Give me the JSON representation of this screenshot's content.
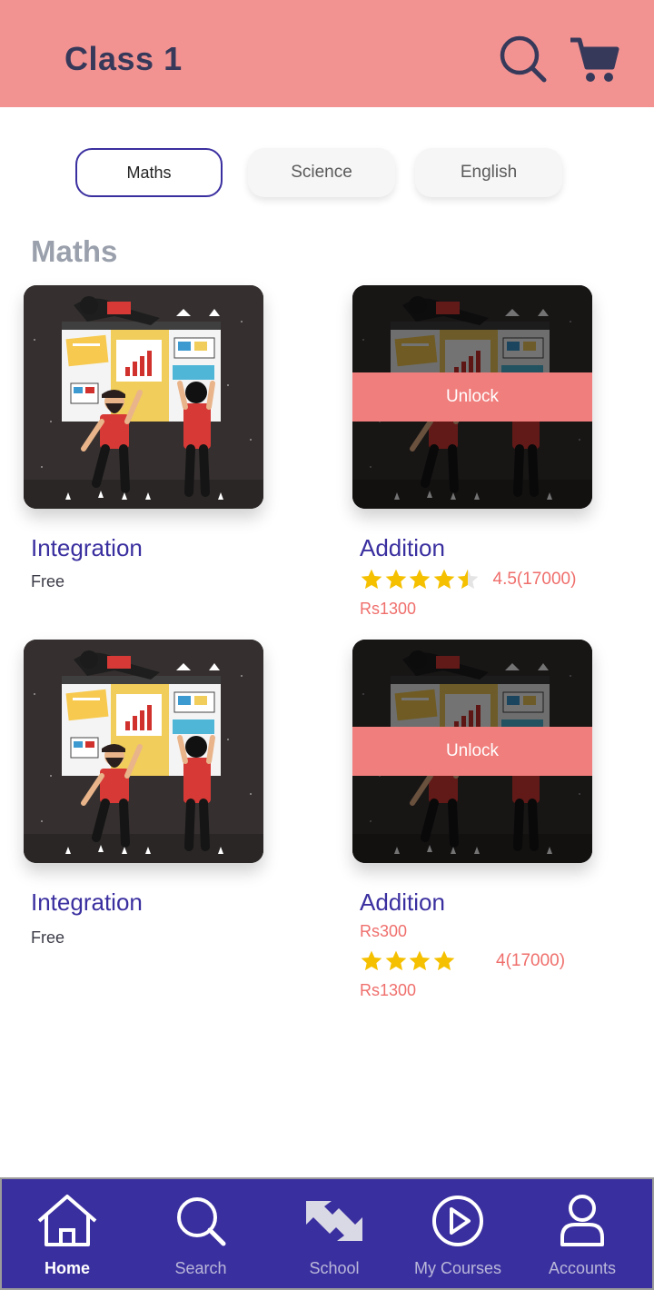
{
  "header": {
    "title": "Class 1",
    "search_icon": "search-icon",
    "cart_icon": "cart-icon"
  },
  "tabs": [
    {
      "label": "Maths",
      "active": true
    },
    {
      "label": "Science",
      "active": false
    },
    {
      "label": "English",
      "active": false
    }
  ],
  "section": {
    "title": "Maths"
  },
  "courses": [
    {
      "title": "Integration",
      "price_label": "Free",
      "locked": false
    },
    {
      "title": "Addition",
      "locked": true,
      "unlock_label": "Unlock",
      "rating": 4.5,
      "rating_text": "4.5(17000)",
      "price": "Rs1300"
    },
    {
      "title": "Integration",
      "price_label": "Free",
      "locked": false
    },
    {
      "title": "Addition",
      "locked": true,
      "unlock_label": "Unlock",
      "old_price": "Rs300",
      "rating": 4,
      "rating_text": "4(17000)",
      "price": "Rs1300"
    }
  ],
  "bottom_nav": {
    "items": [
      {
        "label": "Home",
        "icon": "home-icon",
        "active": true
      },
      {
        "label": "Search",
        "icon": "search-icon",
        "active": false
      },
      {
        "label": "School",
        "icon": "school-icon",
        "active": false
      },
      {
        "label": "My Courses",
        "icon": "play-icon",
        "active": false
      },
      {
        "label": "Accounts",
        "icon": "user-icon",
        "active": false
      }
    ]
  },
  "colors": {
    "header_bg": "#f29391",
    "brand": "#3a2f9f",
    "accent": "#ef6f6c",
    "star": "#f5c000"
  }
}
